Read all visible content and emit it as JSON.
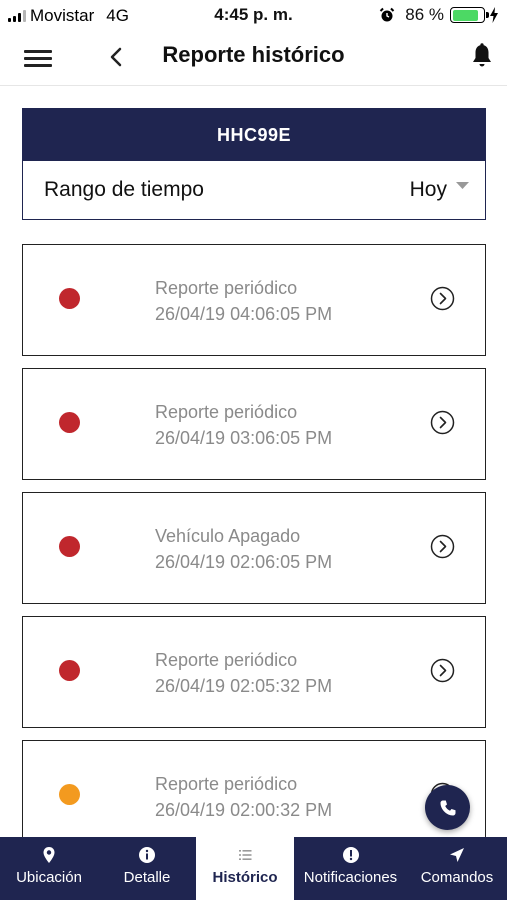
{
  "status_bar": {
    "carrier": "Movistar",
    "network": "4G",
    "time": "4:45 p. m.",
    "battery_percent": "86 %",
    "battery_level": 0.86
  },
  "header": {
    "title": "Reporte histórico"
  },
  "vehicle": {
    "plate": "HHC99E",
    "range_label": "Rango de tiempo",
    "range_value": "Hoy"
  },
  "colors": {
    "navy": "#1f2550",
    "status_red": "#c0272d",
    "status_orange": "#f39a1f",
    "battery_green": "#4cd964"
  },
  "reports": [
    {
      "title": "Reporte periódico",
      "datetime": "26/04/19 04:06:05 PM",
      "status_color": "#c0272d"
    },
    {
      "title": "Reporte periódico",
      "datetime": "26/04/19 03:06:05 PM",
      "status_color": "#c0272d"
    },
    {
      "title": "Vehículo Apagado",
      "datetime": "26/04/19 02:06:05 PM",
      "status_color": "#c0272d"
    },
    {
      "title": "Reporte periódico",
      "datetime": "26/04/19 02:05:32 PM",
      "status_color": "#c0272d"
    },
    {
      "title": "Reporte periódico",
      "datetime": "26/04/19 02:00:32 PM",
      "status_color": "#f39a1f"
    }
  ],
  "tabs": [
    {
      "label": "Ubicación",
      "icon": "map-pin-icon",
      "active": false
    },
    {
      "label": "Detalle",
      "icon": "info-icon",
      "active": false
    },
    {
      "label": "Histórico",
      "icon": "list-icon",
      "active": true
    },
    {
      "label": "Notificaciones",
      "icon": "alert-icon",
      "active": false
    },
    {
      "label": "Comandos",
      "icon": "send-icon",
      "active": false
    }
  ]
}
